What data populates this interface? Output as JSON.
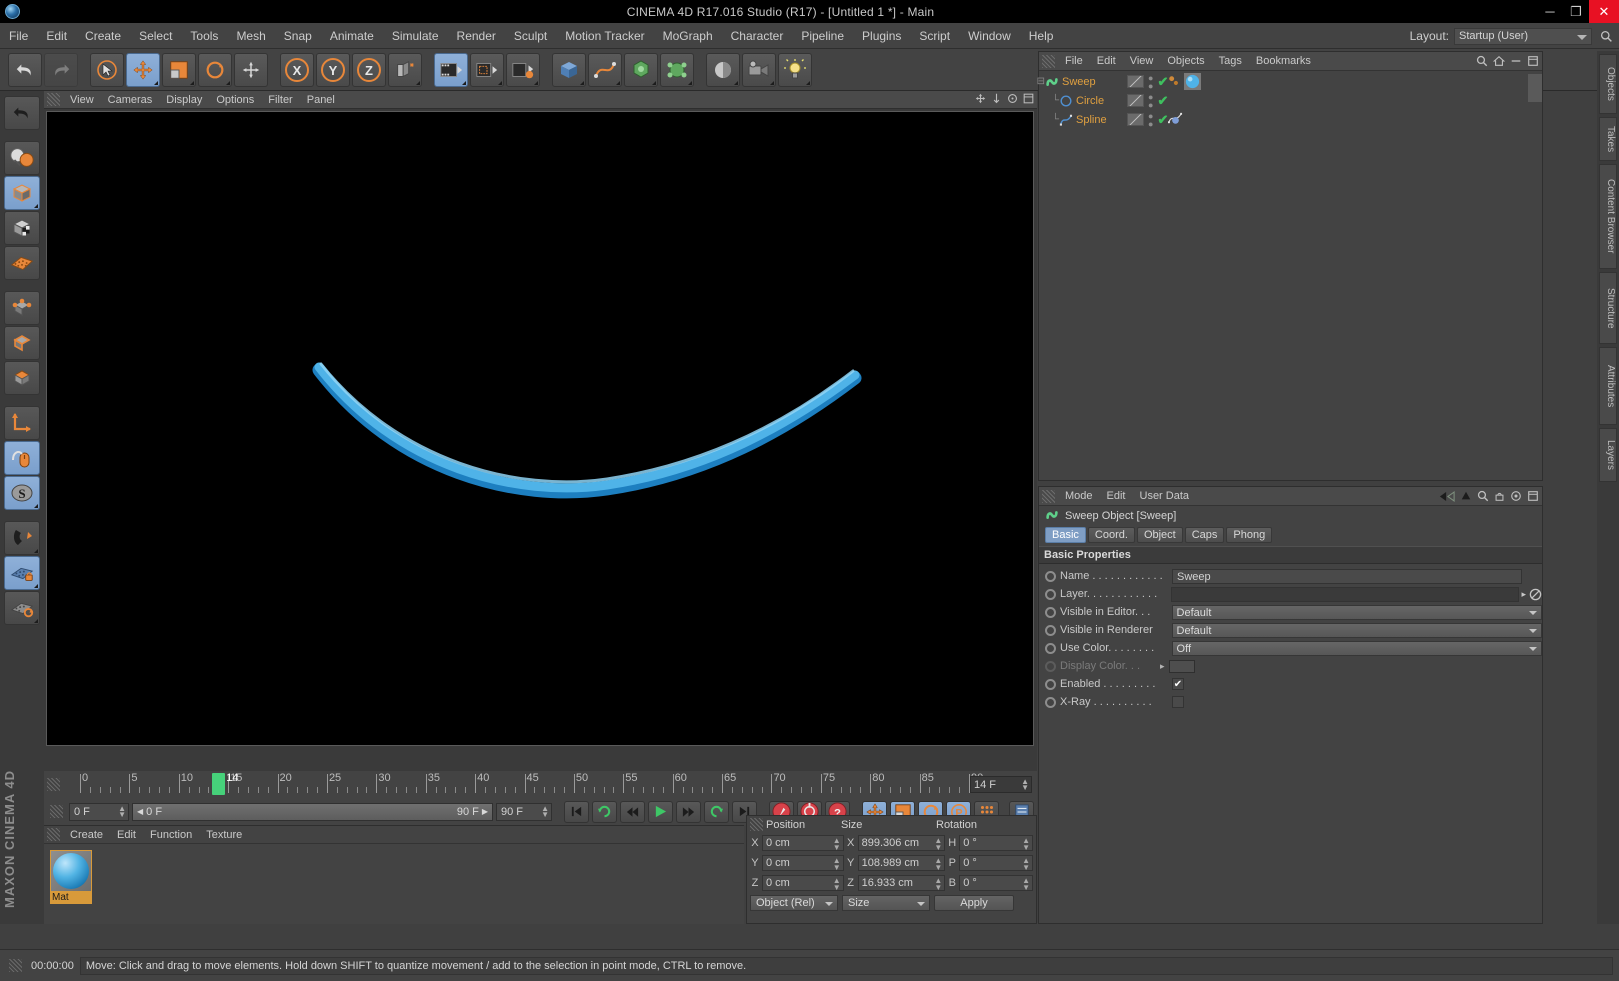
{
  "window": {
    "title": "CINEMA 4D R17.016 Studio (R17) - [Untitled 1 *] - Main",
    "minimize": "─",
    "maximize": "❐",
    "close": "✕"
  },
  "menubar": {
    "items": [
      "File",
      "Edit",
      "Create",
      "Select",
      "Tools",
      "Mesh",
      "Snap",
      "Animate",
      "Simulate",
      "Render",
      "Sculpt",
      "Motion Tracker",
      "MoGraph",
      "Character",
      "Pipeline",
      "Plugins",
      "Script",
      "Window",
      "Help"
    ],
    "layout_label": "Layout:",
    "layout_value": "Startup (User)"
  },
  "toolbar": {
    "tools": [
      {
        "name": "undo-tool",
        "label": "Undo"
      },
      {
        "name": "redo-tool",
        "label": "Redo"
      },
      {
        "name": "live-selection-tool",
        "label": "Live Selection"
      },
      {
        "name": "move-tool",
        "label": "Move"
      },
      {
        "name": "scale-tool",
        "label": "Scale"
      },
      {
        "name": "rotate-tool",
        "label": "Rotate"
      },
      {
        "name": "world-axis-tool",
        "label": "World/Object Axis"
      },
      {
        "name": "lock-x-axis-tool",
        "label": "X"
      },
      {
        "name": "lock-y-axis-tool",
        "label": "Y"
      },
      {
        "name": "lock-z-axis-tool",
        "label": "Z"
      },
      {
        "name": "world-coordinate-tool",
        "label": "World Coordinate System"
      },
      {
        "name": "render-view-tool",
        "label": "Render View"
      },
      {
        "name": "render-region-tool",
        "label": "Render Region"
      },
      {
        "name": "render-settings-tool",
        "label": "Render Settings"
      },
      {
        "name": "add-cube-tool",
        "label": "Cube"
      },
      {
        "name": "add-spline-tool",
        "label": "Spline"
      },
      {
        "name": "add-generator-tool",
        "label": "Generator"
      },
      {
        "name": "add-deformer-tool",
        "label": "Deformer"
      },
      {
        "name": "add-environment-tool",
        "label": "Environment"
      },
      {
        "name": "add-camera-tool",
        "label": "Camera"
      },
      {
        "name": "add-light-tool",
        "label": "Light"
      }
    ]
  },
  "lefttoolbar": {
    "tools": [
      {
        "name": "undo-left-tool",
        "label": "Undo"
      },
      {
        "name": "selection-mode-tool",
        "label": "Selection"
      },
      {
        "name": "model-mode-tool",
        "label": "Model Mode"
      },
      {
        "name": "texture-mode-tool",
        "label": "Texture Mode"
      },
      {
        "name": "polygon-mode-tool",
        "label": "Polygon Mode"
      },
      {
        "name": "point-mode-tool",
        "label": "Point Mode"
      },
      {
        "name": "edge-mode-tool",
        "label": "Edge Mode"
      },
      {
        "name": "object-mode-tool",
        "label": "Object Mode"
      },
      {
        "name": "axis-mode-tool",
        "label": "Enable Axis"
      },
      {
        "name": "viewport-solo-tool",
        "label": "Viewport Solo"
      },
      {
        "name": "snap-settings-tool",
        "label": "Snap Settings"
      },
      {
        "name": "magnet-tool",
        "label": "Magnet"
      },
      {
        "name": "workplane-lock-tool",
        "label": "Workplane Lock"
      },
      {
        "name": "workplane-rotate-tool",
        "label": "Workplane Rotate"
      }
    ],
    "brand": "MAXON CINEMA 4D"
  },
  "viewport": {
    "menus": [
      "View",
      "Cameras",
      "Display",
      "Options",
      "Filter",
      "Panel"
    ],
    "curve_color": "#4fb3e8"
  },
  "timeline": {
    "ticks": [
      0,
      5,
      10,
      15,
      20,
      25,
      30,
      35,
      40,
      45,
      50,
      55,
      60,
      65,
      70,
      75,
      80,
      85,
      90
    ],
    "tick_labels": [
      "0",
      "5",
      "10",
      "15",
      "20",
      "25",
      "30",
      "35",
      "40",
      "45",
      "50",
      "55",
      "60",
      "65",
      "70",
      "75",
      "80",
      "85",
      "90"
    ],
    "current_frame_label": "14",
    "current_frame": 14,
    "frame_field": "14 F",
    "range_start": "0 F",
    "range_end": "90 F",
    "preview_start": "0 F",
    "preview_end": "90 F",
    "max_field": "90 F"
  },
  "transport": {
    "buttons": [
      {
        "name": "go-to-start-button",
        "glyph": "⏮"
      },
      {
        "name": "record-active-objects-button",
        "glyph": "↻"
      },
      {
        "name": "step-back-button",
        "glyph": "◀◀"
      },
      {
        "name": "play-button",
        "glyph": "▶"
      },
      {
        "name": "step-forward-button",
        "glyph": "▶▶"
      },
      {
        "name": "loop-button",
        "glyph": "↺"
      },
      {
        "name": "go-to-end-button",
        "glyph": "⏭"
      },
      {
        "name": "record-key-button",
        "glyph": "•"
      },
      {
        "name": "autokeying-button",
        "glyph": "○"
      },
      {
        "name": "keyframe-selection-button",
        "glyph": "?"
      },
      {
        "name": "position-key-button",
        "glyph": "✥"
      },
      {
        "name": "scale-key-button",
        "glyph": "◢"
      },
      {
        "name": "rotation-key-button",
        "glyph": "↻"
      },
      {
        "name": "parameter-key-button",
        "glyph": "P"
      },
      {
        "name": "point-level-animation-button",
        "glyph": "⠿"
      },
      {
        "name": "timeline-button",
        "glyph": "☰"
      }
    ]
  },
  "material_manager": {
    "menus": [
      "Create",
      "Edit",
      "Function",
      "Texture"
    ],
    "materials": [
      {
        "name": "Mat"
      }
    ]
  },
  "object_manager": {
    "menus": [
      "File",
      "Edit",
      "View",
      "Objects",
      "Tags",
      "Bookmarks"
    ],
    "objects": [
      {
        "name": "Sweep",
        "depth": 0,
        "icon": "sweep-generator-icon",
        "visible_editor": true,
        "visible_renderer": true,
        "enabled": true,
        "tags": [
          "phong-tag",
          "material-tag"
        ]
      },
      {
        "name": "Circle",
        "depth": 1,
        "icon": "circle-spline-icon",
        "visible_editor": true,
        "visible_renderer": true,
        "enabled": true,
        "tags": []
      },
      {
        "name": "Spline",
        "depth": 1,
        "icon": "spline-icon",
        "visible_editor": true,
        "visible_renderer": true,
        "enabled": true,
        "tags": [
          "spline-point-tag"
        ]
      }
    ]
  },
  "attribute_manager": {
    "menus": [
      "Mode",
      "Edit",
      "User Data"
    ],
    "object_title": "Sweep Object [Sweep]",
    "tabs": [
      "Basic",
      "Coord.",
      "Object",
      "Caps",
      "Phong"
    ],
    "selected_tab": "Basic",
    "section_title": "Basic Properties",
    "fields": [
      {
        "label": "Name . . . . . . . . . . . .",
        "type": "text",
        "value": "Sweep",
        "name": "name-field"
      },
      {
        "label": "Layer. . . . . . . . . . . .",
        "type": "layer",
        "value": "",
        "name": "layer-field"
      },
      {
        "label": "Visible in Editor. . .",
        "type": "select",
        "value": "Default",
        "name": "visible-in-editor-select"
      },
      {
        "label": "Visible in Renderer",
        "type": "select",
        "value": "Default",
        "name": "visible-in-renderer-select"
      },
      {
        "label": "Use Color. . . . . . . .",
        "type": "select",
        "value": "Off",
        "name": "use-color-select"
      },
      {
        "label": "Display Color. . .",
        "type": "color",
        "value": "",
        "name": "display-color-field",
        "disabled": true
      },
      {
        "label": "Enabled . . . . . . . . .",
        "type": "checkbox",
        "value": "✔",
        "name": "enabled-checkbox"
      },
      {
        "label": "X-Ray . . . . . . . . . .",
        "type": "checkbox",
        "value": "",
        "name": "xray-checkbox"
      }
    ]
  },
  "coordinate_manager": {
    "headers": [
      "Position",
      "Size",
      "Rotation"
    ],
    "rows": [
      {
        "pos_axis": "X",
        "pos_value": "0 cm",
        "size_axis": "X",
        "size_value": "899.306 cm",
        "rot_axis": "H",
        "rot_value": "0 °"
      },
      {
        "pos_axis": "Y",
        "pos_value": "0 cm",
        "size_axis": "Y",
        "size_value": "108.989 cm",
        "rot_axis": "P",
        "rot_value": "0 °"
      },
      {
        "pos_axis": "Z",
        "pos_value": "0 cm",
        "size_axis": "Z",
        "size_value": "16.933 cm",
        "rot_axis": "B",
        "rot_value": "0 °"
      }
    ],
    "coord_system": "Object (Rel)",
    "size_mode": "Size",
    "apply_label": "Apply"
  },
  "statusbar": {
    "time": "00:00:00",
    "message": "Move: Click and drag to move elements. Hold down SHIFT to quantize movement / add to the selection in point mode, CTRL to remove."
  },
  "right_dock": {
    "tabs": [
      "Objects",
      "Takes",
      "Content Browser",
      "Structure",
      "Attributes",
      "Layers"
    ]
  }
}
